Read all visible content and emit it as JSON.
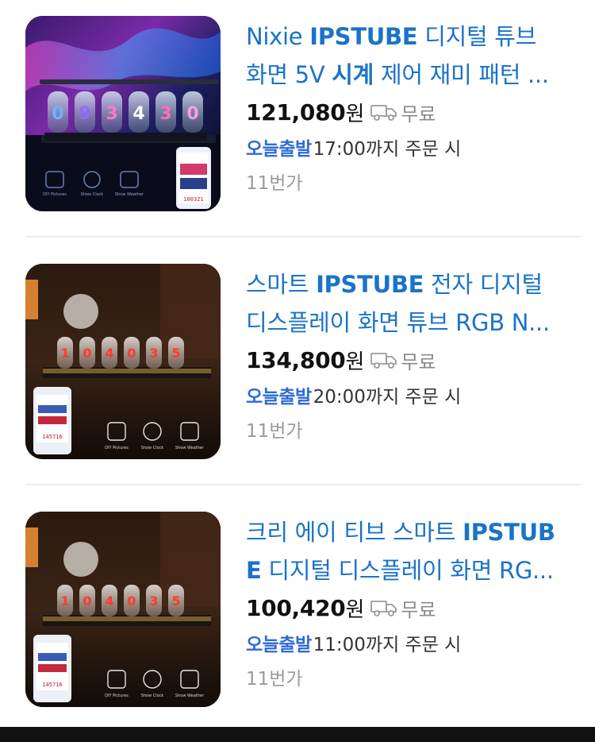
{
  "products": [
    {
      "title_line1_pre": "Nixie ",
      "title_line1_bold": "IPSTUBE",
      "title_line1_post": " 디지털 튜브",
      "title_line2_pre": "화면 5V ",
      "title_line2_bold": "시계",
      "title_line2_post": " 제어 재미 패턴 ...",
      "price": "121,080",
      "currency": "원",
      "shipping": "무료",
      "delivery_badge": "오늘출발",
      "delivery_text": "17:00까지 주문 시",
      "seller": "11번가",
      "thumb_digits": [
        "0",
        "9",
        "3",
        "4",
        "3",
        "0"
      ],
      "thumb_labels": [
        "DIY Pictures",
        "Show Clock",
        "Show Weather"
      ],
      "thumb_phone_readout": "100321"
    },
    {
      "title_line1_pre": "스마트 ",
      "title_line1_bold": "IPSTUBE",
      "title_line1_post": " 전자 디지털",
      "title_line2_pre": "디스플레이 화면 튜브 RGB N...",
      "title_line2_bold": "",
      "title_line2_post": "",
      "price": "134,800",
      "currency": "원",
      "shipping": "무료",
      "delivery_badge": "오늘출발",
      "delivery_text": "20:00까지 주문 시",
      "seller": "11번가",
      "thumb_digits": [
        "1",
        "0",
        "4",
        "0",
        "3",
        "5"
      ],
      "thumb_labels": [
        "DIY Pictures",
        "Show Clock",
        "Show Weather"
      ],
      "thumb_phone_readout": "145716"
    },
    {
      "title_line1_pre": "크리 에이 티브 스마트 ",
      "title_line1_bold": "IPSTUB",
      "title_line1_post": "",
      "title_line2_pre": "",
      "title_line2_bold": "E",
      "title_line2_post": " 디지털 디스플레이 화면 RG...",
      "price": "100,420",
      "currency": "원",
      "shipping": "무료",
      "delivery_badge": "오늘출발",
      "delivery_text": "11:00까지 주문 시",
      "seller": "11번가",
      "thumb_digits": [
        "1",
        "0",
        "4",
        "0",
        "3",
        "5"
      ],
      "thumb_labels": [
        "DIY Pictures",
        "Show Clock",
        "Show Weather"
      ],
      "thumb_phone_readout": "145716"
    }
  ],
  "colors": {
    "title": "#1a73c9",
    "badge": "#2e6bd6",
    "price": "#111111",
    "muted": "#8a8a8a"
  },
  "icons": {
    "shipping": "truck-icon"
  }
}
